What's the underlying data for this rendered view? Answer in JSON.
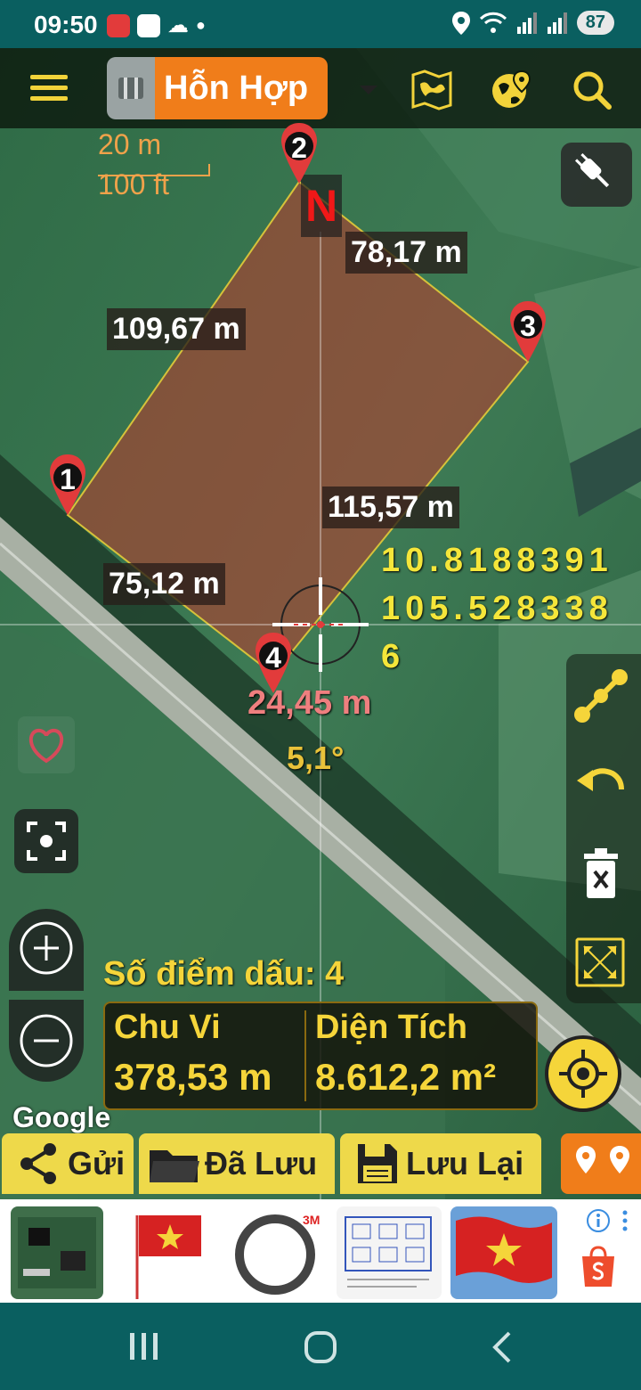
{
  "status_bar": {
    "time": "09:50",
    "battery": "87"
  },
  "toolbar": {
    "map_type_label": "Hỗn Hợp"
  },
  "scale": {
    "metric": "20 m",
    "imperial": "100 ft"
  },
  "compass": {
    "north_label": "N"
  },
  "points": [
    "1",
    "2",
    "3",
    "4"
  ],
  "edge_lengths": {
    "p2_p3": "78,17 m",
    "p1_p2": "109,67 m",
    "p3_p4": "115,57 m",
    "p4_p1": "75,12 m"
  },
  "cursor": {
    "coordinates": "10.8188391 105.5283386",
    "segment_length": "24,45 m",
    "bearing": "5,1°"
  },
  "summary": {
    "marks_label": "Số điểm dấu: 4",
    "perimeter_label": "Chu Vi",
    "perimeter_value": "378,53 m",
    "area_label": "Diện Tích",
    "area_value": "8.612,2 m²"
  },
  "attribution": "Google",
  "actions": {
    "send": "Gửi",
    "saved": "Đã Lưu",
    "save": "Lưu Lại"
  },
  "colors": {
    "accent_yellow": "#F5D53A",
    "accent_orange": "#F07D1A",
    "polygon_fill": "#C0392B",
    "system_bar": "#0A5F60"
  }
}
